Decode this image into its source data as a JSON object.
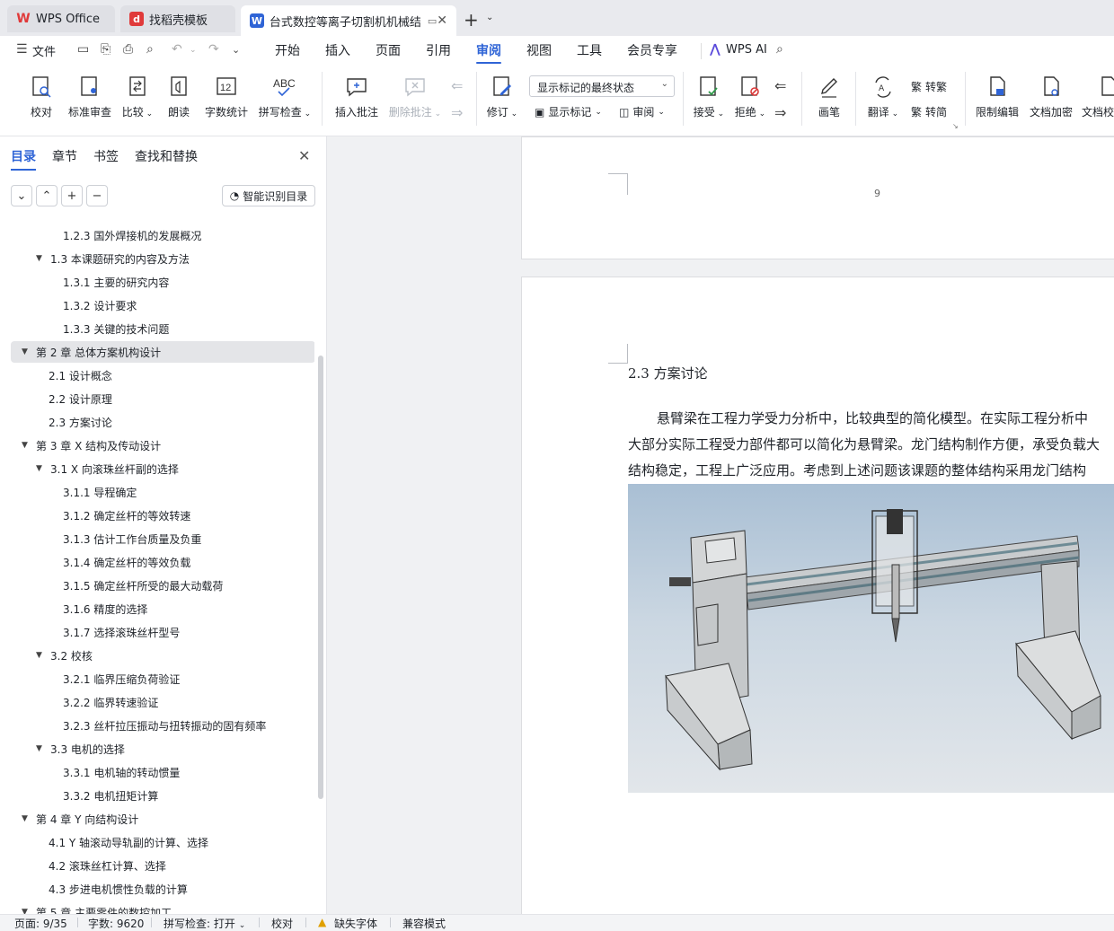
{
  "tabs": {
    "wps_office": "WPS Office",
    "template": "找稻壳模板",
    "document": "台式数控等离子切割机机械结"
  },
  "menu": {
    "file": "文件",
    "items": [
      "开始",
      "插入",
      "页面",
      "引用",
      "审阅",
      "视图",
      "工具",
      "会员专享"
    ],
    "active": "审阅",
    "ai": "WPS AI"
  },
  "ribbon": {
    "proofread": "校对",
    "standard_review": "标准审查",
    "compare": "比较",
    "read_aloud": "朗读",
    "word_count": "字数统计",
    "spell_check": "拼写检查",
    "insert_comment": "插入批注",
    "delete_comment": "删除批注",
    "revise": "修订",
    "markup_select": "显示标记的最终状态",
    "show_markup": "显示标记",
    "review": "审阅",
    "accept": "接受",
    "reject": "拒绝",
    "pen": "画笔",
    "translate": "翻译",
    "to_traditional": "转繁",
    "to_simplified": "转简",
    "restrict_edit": "限制编辑",
    "encrypt": "文档加密",
    "doc_check": "文档校"
  },
  "sidebar": {
    "tabs": [
      "目录",
      "章节",
      "书签",
      "查找和替换"
    ],
    "smart_toc": "智能识别目录",
    "toc": [
      {
        "level": 3,
        "text": "1.2.3 国外焊接机的发展概况",
        "tri": false
      },
      {
        "level": 2,
        "text": "1.3 本课题研究的内容及方法",
        "tri": true
      },
      {
        "level": 3,
        "text": "1.3.1 主要的研究内容",
        "tri": false
      },
      {
        "level": 3,
        "text": "1.3.2 设计要求",
        "tri": false
      },
      {
        "level": 3,
        "text": "1.3.3 关键的技术问题",
        "tri": false
      },
      {
        "level": 1,
        "text": "第 2 章  总体方案机构设计",
        "tri": true,
        "selected": true
      },
      {
        "level": 2,
        "text": "2.1 设计概念",
        "tri": false
      },
      {
        "level": 2,
        "text": "2.2 设计原理",
        "tri": false
      },
      {
        "level": 2,
        "text": "2.3 方案讨论",
        "tri": false
      },
      {
        "level": 1,
        "text": "第 3 章  X 结构及传动设计",
        "tri": true
      },
      {
        "level": 2,
        "text": "3.1 X 向滚珠丝杆副的选择",
        "tri": true
      },
      {
        "level": 3,
        "text": "3.1.1 导程确定",
        "tri": false
      },
      {
        "level": 3,
        "text": "3.1.2 确定丝杆的等效转速",
        "tri": false
      },
      {
        "level": 3,
        "text": "3.1.3 估计工作台质量及负重",
        "tri": false
      },
      {
        "level": 3,
        "text": "3.1.4 确定丝杆的等效负载",
        "tri": false
      },
      {
        "level": 3,
        "text": "3.1.5 确定丝杆所受的最大动载荷",
        "tri": false
      },
      {
        "level": 3,
        "text": "3.1.6 精度的选择",
        "tri": false
      },
      {
        "level": 3,
        "text": "3.1.7 选择滚珠丝杆型号",
        "tri": false
      },
      {
        "level": 2,
        "text": "3.2 校核",
        "tri": true
      },
      {
        "level": 3,
        "text": "3.2.1  临界压缩负荷验证",
        "tri": false
      },
      {
        "level": 3,
        "text": "3.2.2 临界转速验证",
        "tri": false
      },
      {
        "level": 3,
        "text": "3.2.3 丝杆拉压振动与扭转振动的固有频率",
        "tri": false
      },
      {
        "level": 2,
        "text": "3.3 电机的选择",
        "tri": true
      },
      {
        "level": 3,
        "text": "3.3.1 电机轴的转动惯量",
        "tri": false
      },
      {
        "level": 3,
        "text": "3.3.2 电机扭矩计算",
        "tri": false
      },
      {
        "level": 1,
        "text": "第 4 章  Y 向结构设计",
        "tri": true
      },
      {
        "level": 2,
        "text": "4.1 Y 轴滚动导轨副的计算、选择",
        "tri": false
      },
      {
        "level": 2,
        "text": "4.2  滚珠丝杠计算、选择",
        "tri": false
      },
      {
        "level": 2,
        "text": "4.3  步进电机惯性负载的计算",
        "tri": false
      },
      {
        "level": 1,
        "text": "第 5 章  主要零件的数控加工",
        "tri": true
      }
    ]
  },
  "document": {
    "page_number": "9",
    "heading": "2.3 方案讨论",
    "paragraph_lines": [
      "悬臂梁在工程力学受力分析中，比较典型的简化模型。在实际工程分析中",
      "大部分实际工程受力部件都可以简化为悬臂梁。龙门结构制作方便，承受负载大",
      "结构稳定，工程上广泛应用。考虑到上述问题该课题的整体结构采用龙门结构"
    ]
  },
  "status": {
    "page": "页面: 9/35",
    "word_count": "字数: 9620",
    "spell_check": "拼写检查: 打开",
    "proofread": "校对",
    "missing_font": "缺失字体",
    "compat_mode": "兼容模式"
  }
}
